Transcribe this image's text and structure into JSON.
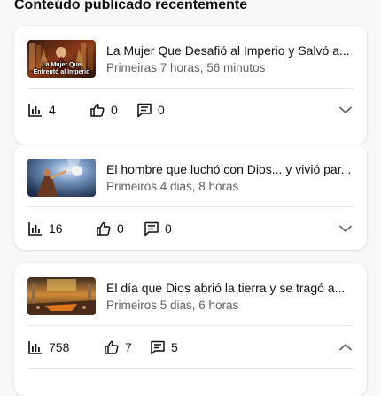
{
  "section": {
    "title": "Conteúdo publicado recentemente"
  },
  "items": [
    {
      "title": "La Mujer Que Desafió al Imperio y Salvó a...",
      "meta": "Primeiras 7 horas, 56 minutos",
      "thumb_caption_1": "La Mujer Que",
      "thumb_caption_2": "Enfrentó al Imperio",
      "views": "4",
      "likes": "0",
      "comments": "0",
      "expand_icon": "chevron-down-icon"
    },
    {
      "title": "El hombre que luchó con Dios... y vivió par...",
      "meta": "Primeiros 4 dias, 8 horas",
      "views": "16",
      "likes": "0",
      "comments": "0",
      "expand_icon": "chevron-down-icon"
    },
    {
      "title": "El día que Dios abrió la tierra y se tragó a...",
      "meta": "Primeiros 5 dias, 6 horas",
      "views": "758",
      "likes": "7",
      "comments": "5",
      "expand_icon": "chevron-up-icon"
    }
  ],
  "colors": {
    "text": "#0f0f0f",
    "secondary": "#606060",
    "divider": "#e5e5e5"
  }
}
